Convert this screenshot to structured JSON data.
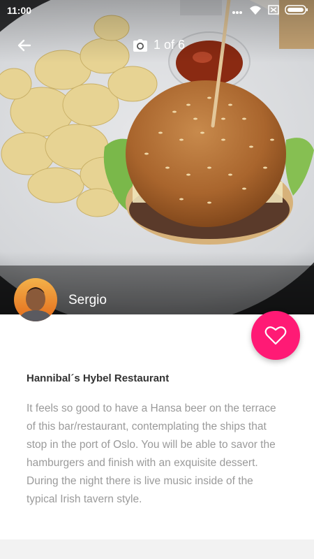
{
  "status_bar": {
    "time": "11:00"
  },
  "header": {
    "counter": "1 of 6"
  },
  "author": {
    "name": "Sergio"
  },
  "place": {
    "title": "Hannibal´s Hybel Restaurant",
    "description": "It feels so good to have a Hansa beer on the terrace of this bar/restaurant, contemplating the ships that stop in the port of Oslo.  You will be able to savor the hamburgers and finish with an exquisite dessert.  During the night there is live music inside of the typical Irish tavern style."
  },
  "colors": {
    "accent": "#ff1a75"
  }
}
